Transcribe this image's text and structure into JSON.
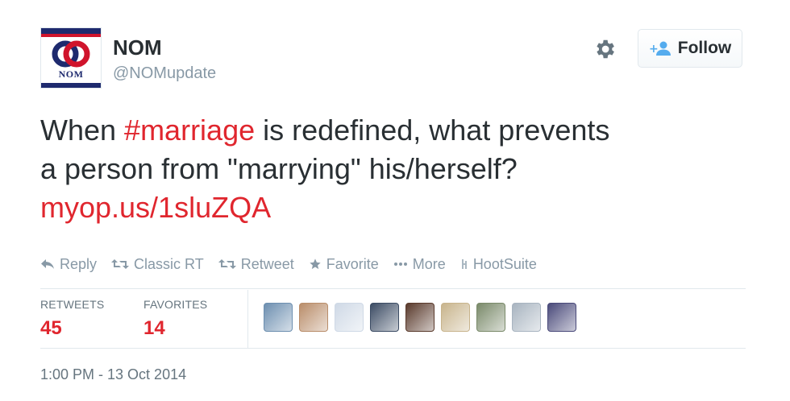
{
  "tweet": {
    "author": {
      "avatar_text": "NOM",
      "name": "NOM",
      "handle": "@NOMupdate",
      "avatar_icon": "nom-logo-icon"
    },
    "follow_label": "Follow",
    "text": {
      "line1_before": "When ",
      "hashtag": "#marriage",
      "line1_after": " is redefined, what prevents",
      "line2": "a person from \"marrying\" his/herself?",
      "link": "myop.us/1sluZQA"
    },
    "actions": [
      {
        "label": "Reply",
        "icon": "reply-icon"
      },
      {
        "label": "Classic RT",
        "icon": "retweet-icon"
      },
      {
        "label": "Retweet",
        "icon": "retweet-icon"
      },
      {
        "label": "Favorite",
        "icon": "star-icon"
      },
      {
        "label": "More",
        "icon": "more-dots-icon"
      },
      {
        "label": "HootSuite",
        "icon": "hootsuite-icon"
      }
    ],
    "stats": {
      "retweets_label": "RETWEETS",
      "retweets": "45",
      "favorites_label": "FAVORITES",
      "favorites": "14"
    },
    "timestamp": "1:00 PM - 13 Oct 2014"
  },
  "colors": {
    "accent_red": "#e0262e",
    "text": "#292f33",
    "muted": "#8899a6",
    "nom_navy": "#1e2a6e",
    "nom_red": "#d0142c"
  },
  "favoriter_avatars": [
    "#6d8fb0",
    "#b98d6a",
    "#cfd9e6",
    "#3c4c64",
    "#5a3a2c",
    "#c8b48c",
    "#7a8a6a",
    "#a8b4c0",
    "#4a4a7a"
  ]
}
